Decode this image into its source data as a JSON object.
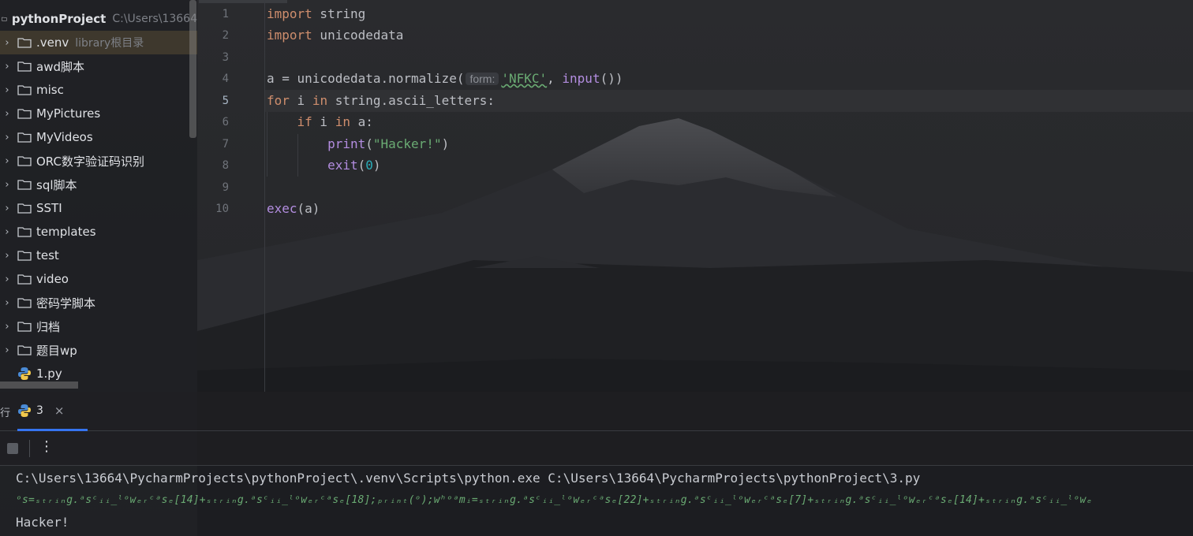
{
  "project": {
    "root": {
      "name": "pythonProject",
      "path": "C:\\Users\\13664"
    },
    "items": [
      {
        "label": ".venv",
        "note": "library根目录",
        "type": "folder",
        "selected": true
      },
      {
        "label": "awd脚本",
        "type": "folder"
      },
      {
        "label": "misc",
        "type": "folder"
      },
      {
        "label": "MyPictures",
        "type": "folder"
      },
      {
        "label": "MyVideos",
        "type": "folder"
      },
      {
        "label": "ORC数字验证码识别",
        "type": "folder"
      },
      {
        "label": "sql脚本",
        "type": "folder"
      },
      {
        "label": "SSTI",
        "type": "folder"
      },
      {
        "label": "templates",
        "type": "folder"
      },
      {
        "label": "test",
        "type": "folder"
      },
      {
        "label": "video",
        "type": "folder"
      },
      {
        "label": "密码学脚本",
        "type": "folder"
      },
      {
        "label": "归档",
        "type": "folder"
      },
      {
        "label": "题目wp",
        "type": "folder"
      },
      {
        "label": "1.py",
        "type": "python-file"
      }
    ]
  },
  "editor": {
    "line_numbers": [
      "1",
      "2",
      "3",
      "4",
      "5",
      "6",
      "7",
      "8",
      "9",
      "10"
    ],
    "active_line": "5",
    "code": {
      "l1_kw": "import",
      "l1_rest": " string",
      "l2_kw": "import",
      "l2_rest": " unicodedata",
      "l4_a": "a = unicodedata.normalize(",
      "l4_hint": "form:",
      "l4_str": "'NFKC'",
      "l4_sep": ", ",
      "l4_fn": "input",
      "l4_end": "())",
      "l5_kw1": "for",
      "l5_mid1": " i ",
      "l5_kw2": "in",
      "l5_rest": " string.ascii_letters:",
      "l6_indent": "    ",
      "l6_kw1": "if",
      "l6_mid": " i ",
      "l6_kw2": "in",
      "l6_rest": " a:",
      "l7_indent": "        ",
      "l7_fn": "print",
      "l7_open": "(",
      "l7_str": "\"Hacker!\"",
      "l7_close": ")",
      "l8_indent": "        ",
      "l8_fn": "exit",
      "l8_open": "(",
      "l8_num": "0",
      "l8_close": ")",
      "l10_fn": "exec",
      "l10_rest": "(a)"
    }
  },
  "run": {
    "cut_tab_label": "行",
    "tab_label": "3",
    "close_glyph": "×",
    "more_glyph": "⋮",
    "console": [
      "C:\\Users\\13664\\PycharmProjects\\pythonProject\\.venv\\Scripts\\python.exe C:\\Users\\13664\\PycharmProjects\\pythonProject\\3.py",
      "ᵒs=ₛₜᵣᵢₙg.ᵃsᶜᵢᵢ_ˡᵒwₑᵣᶜᵃsₑ[14]+ₛₜᵣᵢₙg.ᵃsᶜᵢᵢ_ˡᵒwₑᵣᶜᵃsₑ[18];ₚᵣᵢₙₜ(ᵒ);wʰᵒᵃmᵢ=ₛₜᵣᵢₙg.ᵃsᶜᵢᵢ_ˡᵒwₑᵣᶜᵃsₑ[22]+ₛₜᵣᵢₙg.ᵃsᶜᵢᵢ_ˡᵒwₑᵣᶜᵃsₑ[7]+ₛₜᵣᵢₙg.ᵃsᶜᵢᵢ_ˡᵒwₑᵣᶜᵃsₑ[14]+ₛₜᵣᵢₙg.ᵃsᶜᵢᵢ_ˡᵒwₑ",
      "Hacker!"
    ]
  },
  "colors": {
    "keyword": "#cf8e6d",
    "function": "#b38de0",
    "string": "#6aab73",
    "number": "#2aacb8",
    "accent": "#3574f0"
  }
}
